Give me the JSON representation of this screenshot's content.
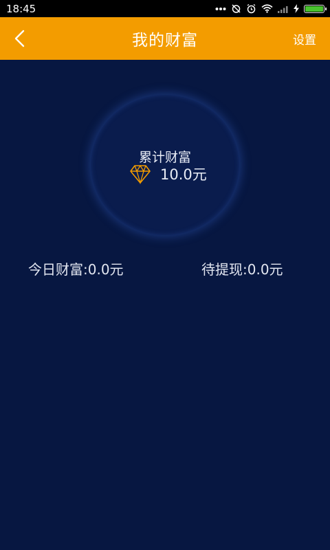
{
  "status_bar": {
    "time": "18:45",
    "icons": [
      "more-dots-icon",
      "alarm-off-icon",
      "alarm-icon",
      "wifi-icon",
      "signal-icon",
      "charging-icon",
      "battery-icon"
    ],
    "battery_color": "#49c22e"
  },
  "header": {
    "title": "我的财富",
    "settings_label": "设置",
    "back_icon": "chevron-left-icon",
    "background": "#f39c00"
  },
  "wealth": {
    "total_label": "累计财富",
    "total_value": "10.0元",
    "icon": "diamond-icon",
    "icon_color": "#f39c00"
  },
  "stats": {
    "today": "今日财富:0.0元",
    "pending": "待提现:0.0元"
  },
  "theme": {
    "background": "#071741"
  }
}
